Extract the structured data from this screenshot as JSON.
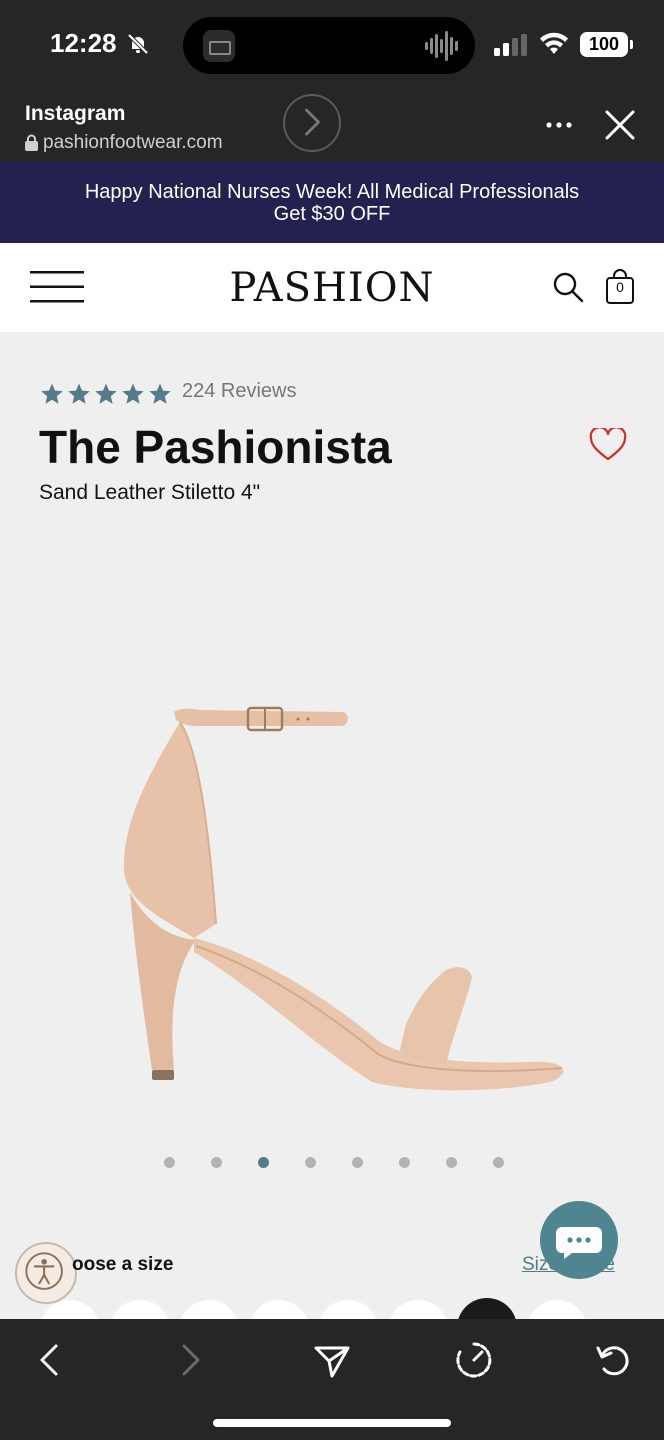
{
  "status_bar": {
    "time": "12:28",
    "battery": "100"
  },
  "browser": {
    "title": "Instagram",
    "url": "pashionfootwear.com"
  },
  "promo": {
    "line1": "Happy National Nurses Week! All Medical Professionals",
    "line2": "Get $30 OFF"
  },
  "site_header": {
    "logo": "PASHION",
    "cart_count": "0"
  },
  "product": {
    "rating_stars": 5,
    "reviews": "224 Reviews",
    "title": "The Pashionista",
    "subtitle": "Sand Leather Stiletto 4\"",
    "image_count": 8,
    "active_image_index": 2
  },
  "size_section": {
    "label": "oose a size",
    "guide_link": "Size Guide",
    "options_visible": 8,
    "selected_index": 6
  },
  "colors": {
    "dark_bar": "#262626",
    "promo_bg": "#232150",
    "accent_teal": "#557b8a",
    "chat_bg": "#4f8590",
    "heart_red": "#d62b2b"
  }
}
